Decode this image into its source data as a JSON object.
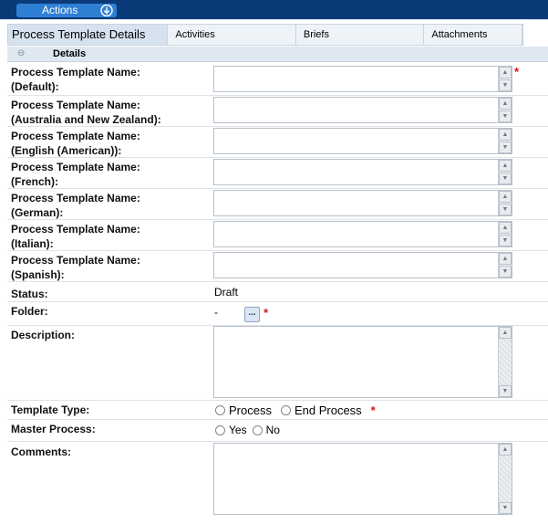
{
  "toolbar": {
    "actions_label": "Actions"
  },
  "tabs": [
    {
      "label": "Process Template Details"
    },
    {
      "label": "Activities"
    },
    {
      "label": "Briefs"
    },
    {
      "label": "Attachments"
    }
  ],
  "section": {
    "collapse_glyph": "⊖",
    "title": "Details"
  },
  "name_fields": [
    {
      "line1": "Process Template Name:",
      "line2": "(Default):",
      "required": "*"
    },
    {
      "line1": "Process Template Name:",
      "line2": "(Australia and New Zealand):"
    },
    {
      "line1": "Process Template Name:",
      "line2": "(English (American)):"
    },
    {
      "line1": "Process Template Name:",
      "line2": "(French):"
    },
    {
      "line1": "Process Template Name:",
      "line2": "(German):"
    },
    {
      "line1": "Process Template Name:",
      "line2": "(Italian):"
    },
    {
      "line1": "Process Template Name:",
      "line2": "(Spanish):"
    }
  ],
  "status": {
    "label": "Status:",
    "value": "Draft"
  },
  "folder": {
    "label": "Folder:",
    "value": "-",
    "browse_label": "...",
    "required": "*"
  },
  "description": {
    "label": "Description:"
  },
  "template_type": {
    "label": "Template Type:",
    "options": [
      "Process",
      "End Process"
    ],
    "required": "*"
  },
  "master_process": {
    "label": "Master Process:",
    "options": [
      "Yes",
      "No"
    ]
  },
  "comments": {
    "label": "Comments:"
  },
  "scroll_glyphs": {
    "up": "▲",
    "down": "▼"
  }
}
